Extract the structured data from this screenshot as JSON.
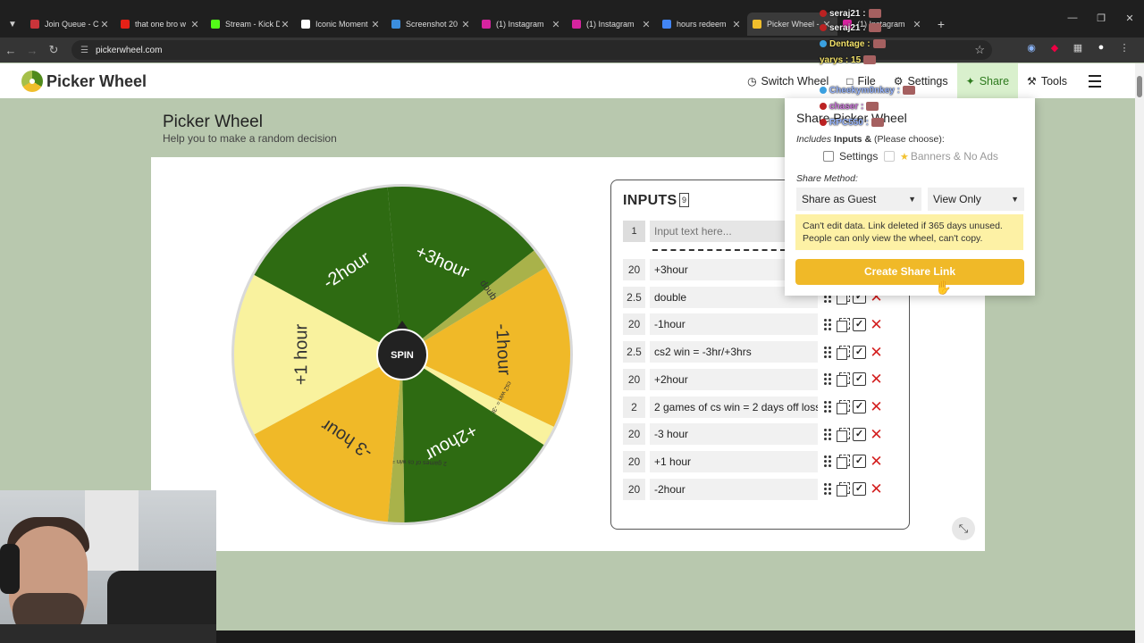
{
  "browser": {
    "tabs": [
      {
        "label": "Join Queue - C",
        "color": "#c9343a",
        "active": false
      },
      {
        "label": "that one bro w",
        "color": "#e62117",
        "active": false
      },
      {
        "label": "Stream - Kick D",
        "color": "#53fc18",
        "active": false
      },
      {
        "label": "Iconic Moment",
        "color": "#ffffff",
        "active": false
      },
      {
        "label": "Screenshot 20",
        "color": "#3b8ede",
        "active": false
      },
      {
        "label": "(1) Instagram",
        "color": "#d6249f",
        "active": false
      },
      {
        "label": "(1) Instagram",
        "color": "#d6249f",
        "active": false
      },
      {
        "label": "hours redeem",
        "color": "#4285f4",
        "active": false
      },
      {
        "label": "Picker Wheel -",
        "color": "#f0be2c",
        "active": true
      },
      {
        "label": "(1) Instagram",
        "color": "#d6249f",
        "active": false
      }
    ],
    "url": "pickerwheel.com"
  },
  "header": {
    "logo": "Picker Wheel",
    "nav": [
      {
        "label": "Switch Wheel",
        "icon": "clock-icon"
      },
      {
        "label": "File",
        "icon": "file-icon"
      },
      {
        "label": "Settings",
        "icon": "gear-icon"
      },
      {
        "label": "Share",
        "icon": "share-icon"
      },
      {
        "label": "Tools",
        "icon": "wrench-icon"
      }
    ]
  },
  "page": {
    "title": "Picker Wheel",
    "subtitle": "Help you to make a random decision"
  },
  "wheel": {
    "center_label": "SPIN",
    "colors": {
      "dark_green": "#2e6b12",
      "gold": "#f0b928",
      "light_yellow": "#f9f29e",
      "olive": "#a9b24a"
    },
    "segments": [
      {
        "label": "+3hour",
        "weight": 20,
        "color": "#2e6b12",
        "text_color": "#ffffff"
      },
      {
        "label": "double",
        "weight": 2.5,
        "color": "#a9b24a",
        "text_color": "#333333"
      },
      {
        "label": "-1hour",
        "weight": 20,
        "color": "#f0b928",
        "text_color": "#333333"
      },
      {
        "label": "cs2 win = -3hr/+3hrs",
        "weight": 2.5,
        "color": "#f9f29e",
        "text_color": "#333333"
      },
      {
        "label": "+2hour",
        "weight": 20,
        "color": "#2e6b12",
        "text_color": "#ffffff"
      },
      {
        "label": "2 games of cs win = 2 days off loss",
        "weight": 2,
        "color": "#a9b24a",
        "text_color": "#333333"
      },
      {
        "label": "-3 hour",
        "weight": 20,
        "color": "#f0b928",
        "text_color": "#333333"
      },
      {
        "label": "+1 hour",
        "weight": 20,
        "color": "#f9f29e",
        "text_color": "#333333"
      },
      {
        "label": "-2hour",
        "weight": 20,
        "color": "#2e6b12",
        "text_color": "#ffffff"
      }
    ]
  },
  "inputs": {
    "title": "INPUTS",
    "count": "9",
    "new_row_number": "1",
    "placeholder": "Input text here...",
    "rows": [
      {
        "weight": "20",
        "text": "+3hour"
      },
      {
        "weight": "2.5",
        "text": "double"
      },
      {
        "weight": "20",
        "text": "-1hour"
      },
      {
        "weight": "2.5",
        "text": "cs2 win = -3hr/+3hrs"
      },
      {
        "weight": "20",
        "text": "+2hour"
      },
      {
        "weight": "2",
        "text": "2 games of cs win = 2 days off loss"
      },
      {
        "weight": "20",
        "text": "-3 hour"
      },
      {
        "weight": "20",
        "text": "+1 hour"
      },
      {
        "weight": "20",
        "text": "-2hour"
      }
    ]
  },
  "share_popup": {
    "title": "Share Picker Wheel",
    "includes_prefix": "Includes",
    "includes_bold": "Inputs &",
    "includes_suffix": "(Please choose):",
    "option_settings": "Settings",
    "option_banners": "Banners & No Ads",
    "method_label": "Share Method:",
    "method_value": "Share as Guest",
    "access_value": "View Only",
    "note": "Can't edit data. Link deleted if 365 days unused. People can only view the wheel, can't copy.",
    "create_button": "Create Share Link"
  },
  "chat": [
    {
      "user": "seraj21 :",
      "color": "#f5f5f5",
      "badge": "#b22"
    },
    {
      "user": "seraj21 :",
      "color": "#f5f5f5",
      "badge": "#b22"
    },
    {
      "user": "Dentage :",
      "color": "#f4e36b",
      "badge": "#3aa0e0"
    },
    {
      "user": "yarys : 15",
      "color": "#f4e36b",
      "badge": ""
    },
    {
      "user": "Cheekym0nkey :",
      "color": "#9ab8ff",
      "badge": "#3aa0e0"
    },
    {
      "user": "chaser :",
      "color": "#d07adf",
      "badge": "#b22"
    },
    {
      "user": "RPC550 :",
      "color": "#9ab8ff",
      "badge": "#b22"
    }
  ]
}
